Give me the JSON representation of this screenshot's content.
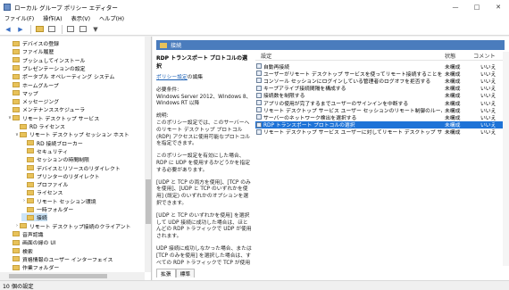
{
  "window": {
    "title": "ローカル グループ ポリシー エディター",
    "controls": [
      "—",
      "□",
      "✕"
    ]
  },
  "menu": [
    "ファイル(F)",
    "操作(A)",
    "表示(V)",
    "ヘルプ(H)"
  ],
  "toolbar_icons": [
    "back-icon",
    "forward-icon",
    "up-folder-icon",
    "show-tree-icon",
    "properties-icon",
    "help-icon",
    "filter-icon"
  ],
  "tree": {
    "items": [
      {
        "label": "デバイスの登録",
        "indent": 1,
        "arrow": ""
      },
      {
        "label": "ファイル履歴",
        "indent": 1,
        "arrow": ""
      },
      {
        "label": "プッシュしてインストール",
        "indent": 1,
        "arrow": ""
      },
      {
        "label": "プレゼンテーションの設定",
        "indent": 1,
        "arrow": ""
      },
      {
        "label": "ポータブル オペレーティング システム",
        "indent": 1,
        "arrow": ""
      },
      {
        "label": "ホームグループ",
        "indent": 1,
        "arrow": ""
      },
      {
        "label": "マップ",
        "indent": 1,
        "arrow": ""
      },
      {
        "label": "メッセージング",
        "indent": 1,
        "arrow": ""
      },
      {
        "label": "メンテナンススケジューラ",
        "indent": 1,
        "arrow": ""
      },
      {
        "label": "リモート デスクトップ サービス",
        "indent": 1,
        "arrow": "v"
      },
      {
        "label": "RD ライセンス",
        "indent": 2,
        "arrow": ""
      },
      {
        "label": "リモート デスクトップ セッション ホスト",
        "indent": 2,
        "arrow": "v"
      },
      {
        "label": "RD 接続ブローカー",
        "indent": 3,
        "arrow": ""
      },
      {
        "label": "セキュリティ",
        "indent": 3,
        "arrow": ""
      },
      {
        "label": "セッションの時間制限",
        "indent": 3,
        "arrow": ""
      },
      {
        "label": "デバイスとリソースのリダイレクト",
        "indent": 3,
        "arrow": ""
      },
      {
        "label": "プリンターのリダイレクト",
        "indent": 3,
        "arrow": ""
      },
      {
        "label": "プロファイル",
        "indent": 3,
        "arrow": ""
      },
      {
        "label": "ライセンス",
        "indent": 3,
        "arrow": ""
      },
      {
        "label": "リモート セッション環境",
        "indent": 3,
        "arrow": ">"
      },
      {
        "label": "一時フォルダー",
        "indent": 3,
        "arrow": ""
      },
      {
        "label": "接続",
        "indent": 3,
        "arrow": "",
        "selected": true
      },
      {
        "label": "リモート デスクトップ接続のクライアント",
        "indent": 2,
        "arrow": ">"
      },
      {
        "label": "音声認識",
        "indent": 1,
        "arrow": ""
      },
      {
        "label": "画面の縁の UI",
        "indent": 1,
        "arrow": ""
      },
      {
        "label": "検索",
        "indent": 1,
        "arrow": ""
      },
      {
        "label": "資格情報のユーザー インターフェイス",
        "indent": 1,
        "arrow": ""
      },
      {
        "label": "作業フォルダー",
        "indent": 1,
        "arrow": ""
      }
    ]
  },
  "right": {
    "header": "接続",
    "detail": {
      "title": "RDP トランスポート プロトコルの選択",
      "edit_link": "ポリシー設定",
      "edit_suffix": "の編集",
      "requirements": "必要条件:\nWindows Server 2012、Windows 8、Windows RT 以降",
      "description": "説明:\nこのポリシー設定では、このサーバーへのリモート デスクトップ プロトコル (RDP) アクセスに使用可能なプロトコルを指定できます。",
      "p2": "このポリシー設定を有効にした場合、RDP に UDP を使用するかどうかを指定する必要があります。",
      "p3": "[UDP と TCP の両方を使用]、[TCP のみを使用]、[UDP と TCP のいずれかを使用] (既定) のいずれかのオプションを選択できます。",
      "p4": "[UDP と TCP のいずれかを使用] を選択して UDP 接続に成功した場合は、ほとんどの RDP トラフィックで UDP が使用されます。",
      "p5": "UDP 接続に成功しなかった場合、または [TCP のみを使用] を選択した場合は、すべての RDP トラフィックで TCP が使用されます。"
    },
    "columns": {
      "name": "設定",
      "state": "状態",
      "comment": "コメント"
    },
    "rows": [
      {
        "name": "自動再接続",
        "state": "未構成",
        "comment": "いいえ"
      },
      {
        "name": "ユーザーがリモート デスクトップ サービスを使ってリモート接続することを...",
        "state": "未構成",
        "comment": "いいえ"
      },
      {
        "name": "コンソール セッションにログインしている管理者のログオフを拒否する",
        "state": "未構成",
        "comment": "いいえ"
      },
      {
        "name": "キープアライブ接続間隔を構成する",
        "state": "未構成",
        "comment": "いいえ"
      },
      {
        "name": "接続数を制限する",
        "state": "未構成",
        "comment": "いいえ"
      },
      {
        "name": "アプリの使用が完了するまでユーザーのサインインを中断する",
        "state": "未構成",
        "comment": "いいえ"
      },
      {
        "name": "リモート デスクトップ サービス ユーザー セッションのリモート制御のルール...",
        "state": "未構成",
        "comment": "いいえ"
      },
      {
        "name": "サーバーのネットワーク検出を選択する",
        "state": "未構成",
        "comment": "いいえ"
      },
      {
        "name": "RDP トランスポート プロトコルの選択",
        "state": "未構成",
        "comment": "いいえ",
        "selected": true
      },
      {
        "name": "リモート デスクトップ サービス ユーザーに対してリモート デスクトップ サ...",
        "state": "未構成",
        "comment": "いいえ"
      }
    ],
    "tabs": [
      "拡張",
      "標準"
    ]
  },
  "status": "10 個の設定"
}
